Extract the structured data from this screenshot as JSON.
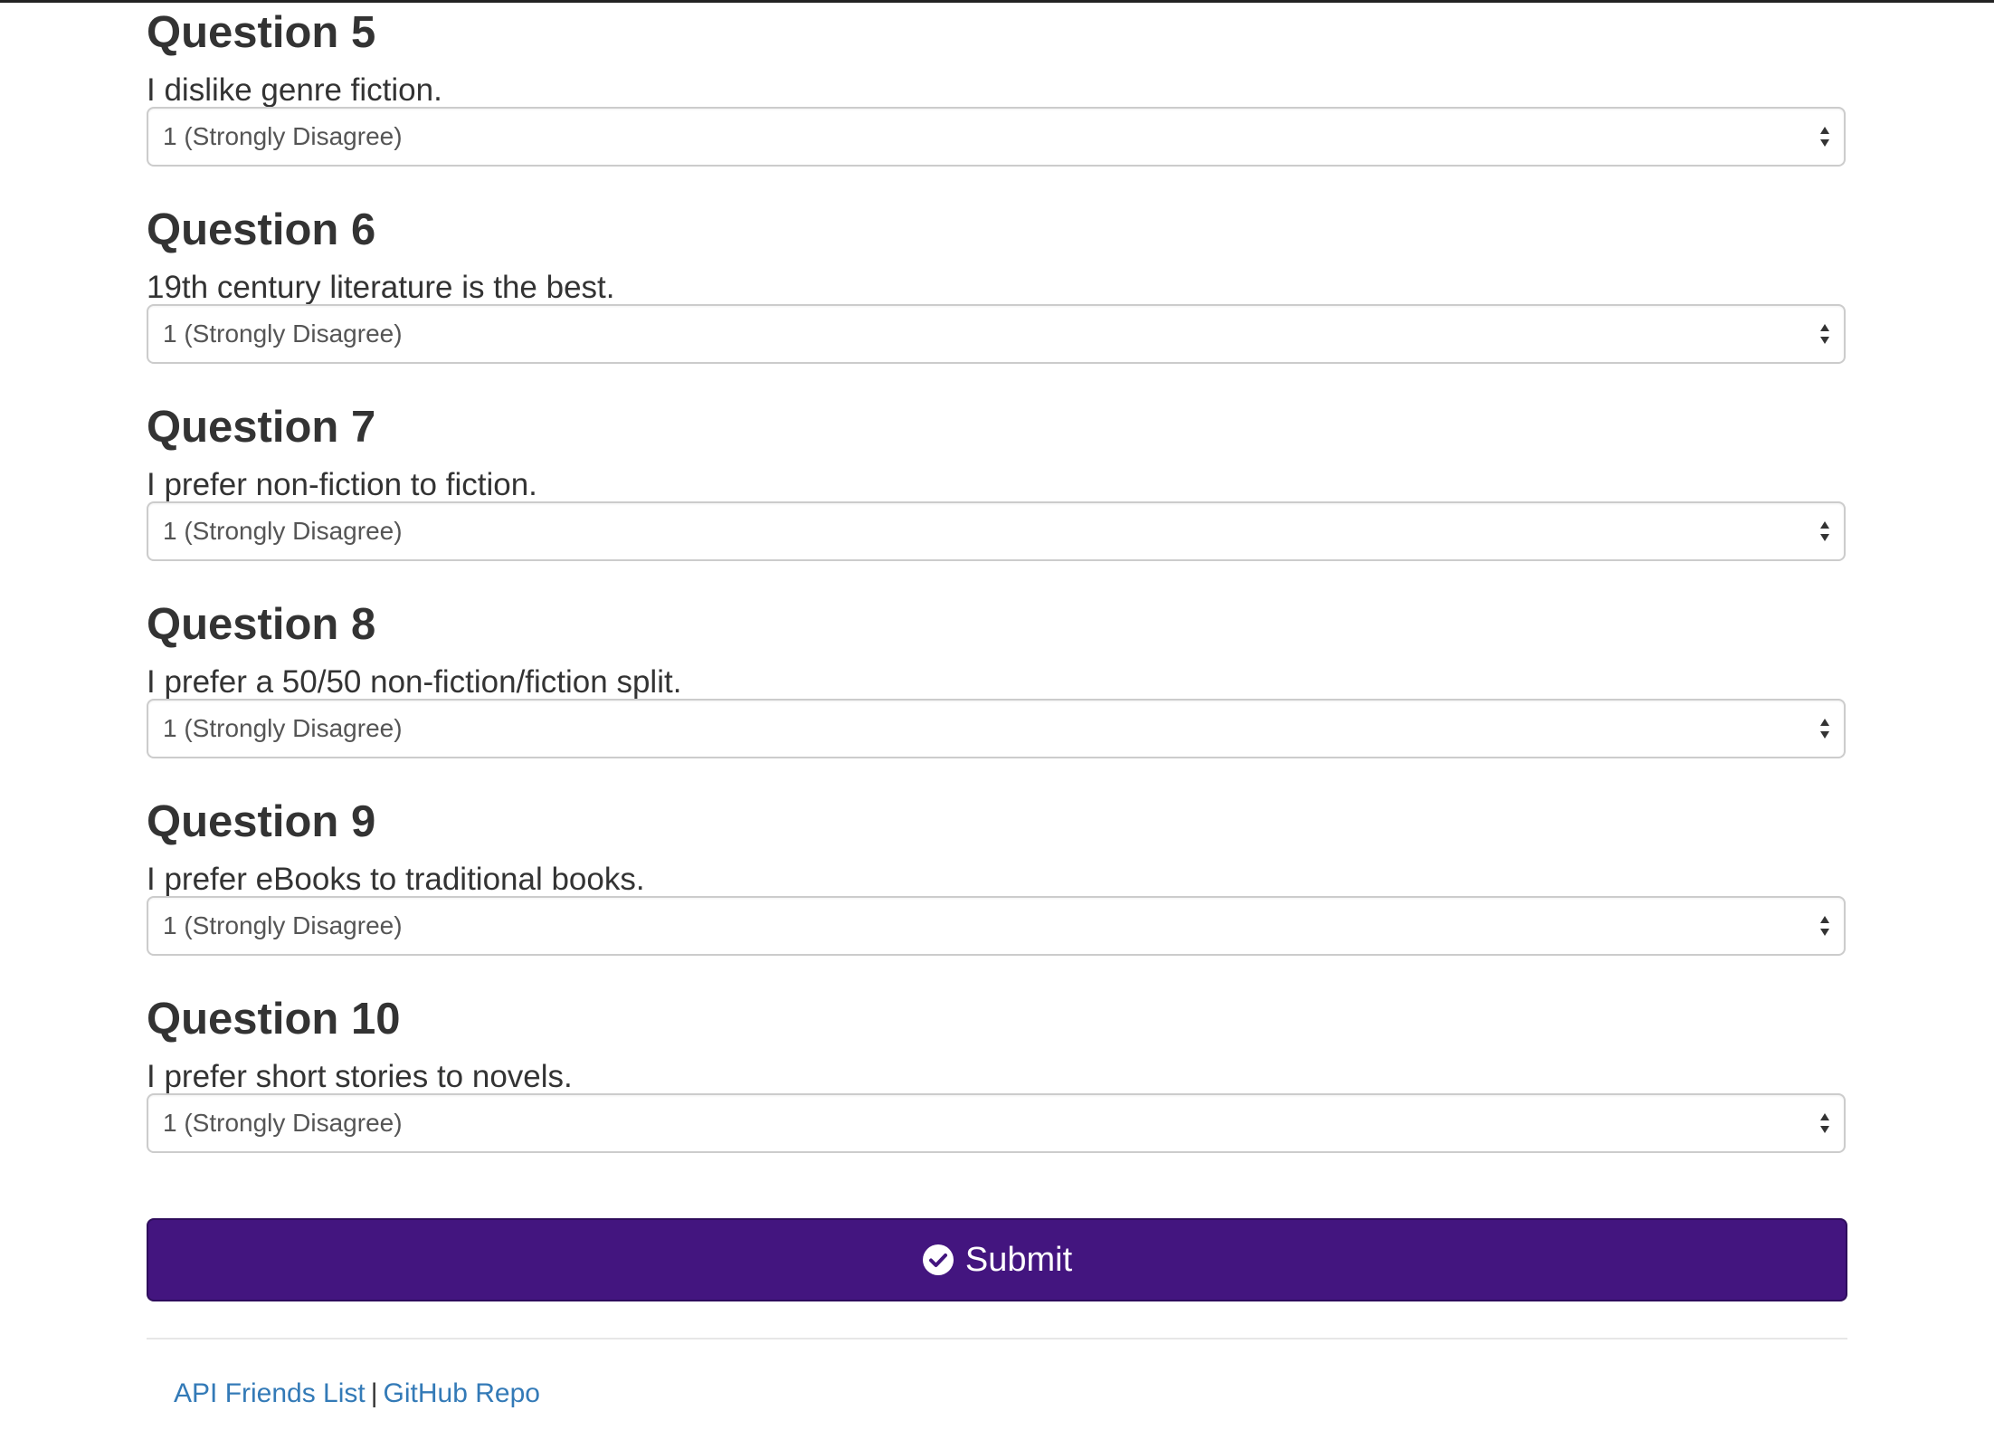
{
  "questions": [
    {
      "title": "Question 5",
      "text": "I dislike genre fiction.",
      "selected": "1 (Strongly Disagree)"
    },
    {
      "title": "Question 6",
      "text": "19th century literature is the best.",
      "selected": "1 (Strongly Disagree)"
    },
    {
      "title": "Question 7",
      "text": "I prefer non-fiction to fiction.",
      "selected": "1 (Strongly Disagree)"
    },
    {
      "title": "Question 8",
      "text": "I prefer a 50/50 non-fiction/fiction split.",
      "selected": "1 (Strongly Disagree)"
    },
    {
      "title": "Question 9",
      "text": "I prefer eBooks to traditional books.",
      "selected": "1 (Strongly Disagree)"
    },
    {
      "title": "Question 10",
      "text": "I prefer short stories to novels.",
      "selected": "1 (Strongly Disagree)"
    }
  ],
  "submit": {
    "label": "Submit",
    "icon": "check-circle-icon",
    "color": "#43157f"
  },
  "footer": {
    "link1": "API Friends List",
    "separator": "|",
    "link2": "GitHub Repo",
    "link_color": "#337ab7"
  }
}
